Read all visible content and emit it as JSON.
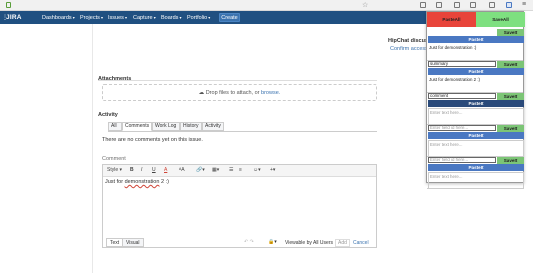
{
  "browser": {
    "bookmark_star": "☆"
  },
  "jira": {
    "logo": "JIRA",
    "nav": [
      "Dashboards",
      "Projects",
      "Issues",
      "Capture",
      "Boards",
      "Portfolio"
    ],
    "create_label": "Create"
  },
  "attachments": {
    "heading": "Attachments",
    "drop_text": "Drop files to attach, or ",
    "browse_link": "browse."
  },
  "activity": {
    "heading": "Activity",
    "tabs": [
      "All",
      "Comments",
      "Work Log",
      "History",
      "Activity"
    ],
    "active_tab": "Comments",
    "empty_text": "There are no comments yet on this issue."
  },
  "comment": {
    "label": "Comment",
    "toolbar": {
      "style": "Style",
      "bold": "B",
      "italic": "I",
      "underline": "U",
      "color": "A",
      "size": "ᴬA"
    },
    "body_prefix": "Just for ",
    "body_err": "demonstration",
    "body_suffix": " 2 :)",
    "bottom_tabs": [
      "Text",
      "Visual"
    ],
    "viewable": "Viewable by All Users",
    "add_label": "Add",
    "cancel_label": "Cancel"
  },
  "hipchat": {
    "heading": "HipChat discuss",
    "confirm": "Confirm access"
  },
  "popup": {
    "paste_all": "PasteAll",
    "save_all": "SaveAll",
    "paste": "PasteIt",
    "save": "SaveIt",
    "entries": [
      {
        "field": "",
        "field_placeholder": "",
        "text": "Just for demonstration :)",
        "colored": false,
        "save_bg": "#7cc576",
        "paste_bg": "#4a78c2"
      },
      {
        "field": "summary",
        "field_placeholder": "",
        "text": "Just for demonstration 2 :)",
        "colored": true,
        "save_bg": "#7cc576",
        "paste_bg": "#4a78c2"
      },
      {
        "field": "comment",
        "field_placeholder": "",
        "text": "",
        "text_placeholder": "Enter text here...",
        "save_bg": "#7cc576",
        "paste_bg": "#2a4a7a"
      },
      {
        "field": "",
        "field_placeholder": "Enter field id here...",
        "text": "",
        "text_placeholder": "Enter text here...",
        "save_bg": "#7cc576",
        "paste_bg": "#4a78c2"
      },
      {
        "field": "",
        "field_placeholder": "Enter field id here...",
        "text": "",
        "text_placeholder": "Enter text here...",
        "save_bg": "#7cc576",
        "paste_bg": "#4a78c2"
      }
    ],
    "colors": {
      "paste_all": "#e8443a",
      "save_all": "#7ee080",
      "save": "#7cc576",
      "paste": "#4a78c2"
    }
  }
}
